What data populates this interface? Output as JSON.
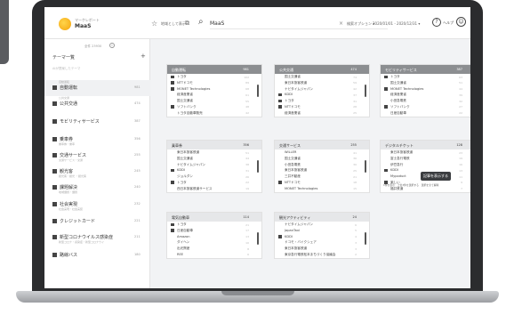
{
  "header": {
    "brand_sub": "マーケレポート",
    "brand_name": "MaaS",
    "register_link": "地域として表示",
    "search_query": "MaaS",
    "clear": "×",
    "filter_option": "検索オプション ▾",
    "date_range": "2020/01/01 - 2020/12/31 ▾",
    "help_label": "ヘルプ"
  },
  "sidebar": {
    "count_label": "全件 23930",
    "theme_title": "テーマ一覧",
    "search_placeholder": "AIが提案したテーマ",
    "items": [
      {
        "sub": "自動運転",
        "label": "自動運転",
        "count": "981",
        "detail": ""
      },
      {
        "sub": "公共交通",
        "label": "公共交通",
        "count": "474",
        "detail": ""
      },
      {
        "sub": "",
        "label": "モビリティサービス",
        "count": "387",
        "detail": ""
      },
      {
        "sub": "",
        "label": "乗車券",
        "count": "356",
        "detail": "乗車券・乗車"
      },
      {
        "sub": "",
        "label": "交通サービス",
        "count": "255",
        "detail": "交通サービス・交通"
      },
      {
        "sub": "",
        "label": "観光客",
        "count": "245",
        "detail": "観光客・観光 ・観光客"
      },
      {
        "sub": "",
        "label": "課題解決",
        "count": "240",
        "detail": "地域課題・課題"
      },
      {
        "sub": "",
        "label": "社会実現",
        "count": "232",
        "detail": "社会実現・社会実装"
      },
      {
        "sub": "",
        "label": "クレジットカード",
        "count": "221",
        "detail": ""
      },
      {
        "sub": "",
        "label": "新型コロナウイルス感染症",
        "count": "211",
        "detail": "新型コロナ・感染症・新型コロナウイ"
      },
      {
        "sub": "",
        "label": "路線バス",
        "count": "180",
        "detail": ""
      }
    ]
  },
  "cards": [
    {
      "title": "自動運転",
      "count": "981",
      "style": "dark",
      "rows": [
        {
          "name": "トヨタ",
          "ct": "102",
          "checked": true
        },
        {
          "name": "NTTドコモ",
          "ct": "89",
          "checked": true
        },
        {
          "name": "MONET Technologies",
          "ct": "68",
          "checked": true
        },
        {
          "name": "経済産業省",
          "ct": "61",
          "checked": false
        },
        {
          "name": "国土交通省",
          "ct": "55",
          "checked": false
        },
        {
          "name": "ソフトバンク",
          "ct": "48",
          "checked": true
        },
        {
          "name": "トヨタ自動車販売",
          "ct": "42",
          "checked": false
        }
      ]
    },
    {
      "title": "公共交通",
      "count": "474",
      "style": "dark",
      "rows": [
        {
          "name": "国土交通省",
          "ct": "74",
          "checked": false
        },
        {
          "name": "東日本旅客鉄道",
          "ct": "59",
          "checked": false
        },
        {
          "name": "ナビタイムジャパン",
          "ct": "42",
          "checked": false
        },
        {
          "name": "KDDI",
          "ct": "37",
          "checked": true
        },
        {
          "name": "トヨタ",
          "ct": "31",
          "checked": true
        },
        {
          "name": "NTTドコモ",
          "ct": "28",
          "checked": true
        },
        {
          "name": "経済産業省",
          "ct": "25",
          "checked": false
        }
      ]
    },
    {
      "title": "モビリティサービス",
      "count": "387",
      "style": "dark",
      "rows": [
        {
          "name": "トヨタ",
          "ct": "63",
          "checked": true
        },
        {
          "name": "国土交通省",
          "ct": "51",
          "checked": false
        },
        {
          "name": "MONET Technologies",
          "ct": "44",
          "checked": true
        },
        {
          "name": "経済産業省",
          "ct": "39",
          "checked": false
        },
        {
          "name": "小田急電鉄",
          "ct": "32",
          "checked": false
        },
        {
          "name": "ソフトバンク",
          "ct": "27",
          "checked": true
        },
        {
          "name": "日産自動車",
          "ct": "22",
          "checked": false
        }
      ]
    },
    {
      "title": "乗車券",
      "count": "356",
      "style": "light",
      "rows": [
        {
          "name": "東日本旅客鉄道",
          "ct": "51",
          "checked": false
        },
        {
          "name": "国土交通省",
          "ct": "44",
          "checked": false
        },
        {
          "name": "ナビタイムジャパン",
          "ct": "38",
          "checked": false
        },
        {
          "name": "KDDI",
          "ct": "31",
          "checked": true
        },
        {
          "name": "ジョルダン",
          "ct": "26",
          "checked": false
        },
        {
          "name": "トヨタ",
          "ct": "22",
          "checked": true
        },
        {
          "name": "西日本旅客鉄道サービス",
          "ct": "19",
          "checked": false
        }
      ]
    },
    {
      "title": "交通サービス",
      "count": "255",
      "style": "light",
      "rows": [
        {
          "name": "WILLER",
          "ct": "41",
          "checked": false
        },
        {
          "name": "国土交通省",
          "ct": "36",
          "checked": false
        },
        {
          "name": "小田急電鉄",
          "ct": "30",
          "checked": false
        },
        {
          "name": "東日本旅客鉄道",
          "ct": "25",
          "checked": false
        },
        {
          "name": "三井不動産",
          "ct": "21",
          "checked": false
        },
        {
          "name": "NTTドコモ",
          "ct": "18",
          "checked": true
        },
        {
          "name": "MONET Technologies",
          "ct": "15",
          "checked": false
        }
      ]
    },
    {
      "title": "デジタルチケット",
      "count": "128",
      "style": "light",
      "rows": [
        {
          "name": "東日本旅客鉄道",
          "ct": "23",
          "checked": false
        },
        {
          "name": "富士急行電鉄",
          "ct": "19",
          "checked": false
        },
        {
          "name": "伊豆急行",
          "ct": "16",
          "checked": false
        },
        {
          "name": "KDDI",
          "ct": "13",
          "checked": true
        },
        {
          "name": "Mypoduct",
          "ct": "11",
          "checked": false
        },
        {
          "name": "楽しい",
          "ct": "9",
          "checked": true
        },
        {
          "name": "福井鉄道",
          "ct": "7",
          "checked": false
        }
      ]
    },
    {
      "title": "電気自動車",
      "count": "114",
      "style": "light",
      "rows": [
        {
          "name": "トヨタ",
          "ct": "21",
          "checked": true
        },
        {
          "name": "日産自動車",
          "ct": "17",
          "checked": true
        },
        {
          "name": "Amazon",
          "ct": "13",
          "checked": false
        },
        {
          "name": "ダイヘン",
          "ct": "10",
          "checked": false
        },
        {
          "name": "出光興産",
          "ct": "8",
          "checked": false
        },
        {
          "name": "REE",
          "ct": "6",
          "checked": false
        }
      ]
    },
    {
      "title": "観光アクティビティ",
      "count": "24",
      "style": "light",
      "rows": [
        {
          "name": "ナビタイムジャパン",
          "ct": "6",
          "checked": false
        },
        {
          "name": "JapanTaxi",
          "ct": "5",
          "checked": false
        },
        {
          "name": "KDDI",
          "ct": "4",
          "checked": true
        },
        {
          "name": "ドコモ・バイクシェア",
          "ct": "3",
          "checked": false
        },
        {
          "name": "東日本旅客鉄道",
          "ct": "3",
          "checked": false
        },
        {
          "name": "東京急行電鉄松本まちづくり協議会",
          "ct": "2",
          "checked": false
        }
      ]
    }
  ],
  "tooltip": "記事を表示する",
  "mini_actions": "1件を表示　上位3件を選択する　選択を全て解除"
}
